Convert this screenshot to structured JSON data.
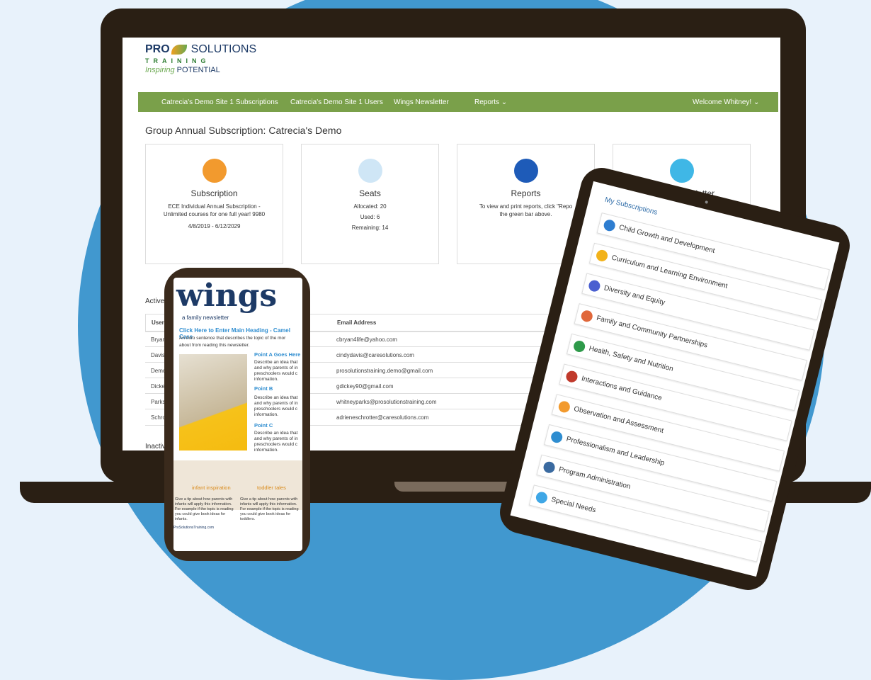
{
  "logo": {
    "pro": "PRO",
    "solutions": "SOLUTIONS",
    "training": "TRAINING",
    "tagline_a": "Inspiring",
    "tagline_b": "POTENTIAL"
  },
  "nav": {
    "items": [
      "Catrecia's Demo Site 1 Subscriptions",
      "Catrecia's Demo Site 1 Users",
      "Wings Newsletter",
      "Reports ⌄"
    ],
    "welcome": "Welcome Whitney! ⌄"
  },
  "page_title": "Group Annual Subscription: Catrecia's Demo",
  "cards": {
    "subscription": {
      "title": "Subscription",
      "line1": "ECE Individual Annual Subscription -",
      "line2": "Unlimited courses for one full year! 9980",
      "dates": "4/8/2019 - 6/12/2029",
      "icon": "books-icon",
      "color": "#f29a2e"
    },
    "seats": {
      "title": "Seats",
      "allocated": "Allocated: 20",
      "used": "Used: 6",
      "remaining": "Remaining: 14",
      "icon": "people-icon",
      "color": "#cfe6f6"
    },
    "reports": {
      "title": "Reports",
      "line1": "To view and print reports, click \"Repo",
      "line2": "the green bar above.",
      "icon": "bar-chart-icon",
      "color": "#1e5bb8"
    },
    "newsletter": {
      "title": "Wings Newsletter",
      "icon": "owl-icon",
      "color": "#3fb7e6"
    }
  },
  "users": {
    "section_label": "Active",
    "header_user": "User",
    "header_email": "Email Address",
    "rows": [
      {
        "user": "Bryan",
        "email": "cbryan4life@yahoo.com"
      },
      {
        "user": "Davis",
        "email": "cindydavis@caresolutions.com"
      },
      {
        "user": "Demo",
        "email": "prosolutionstraining.demo@gmail.com"
      },
      {
        "user": "Dickey",
        "email": "gdickey90@gmail.com"
      },
      {
        "user": "Parks,",
        "email": "whitneyparks@prosolutionstraining.com"
      },
      {
        "user": "Schro",
        "email": "adrieneschrotter@caresolutions.com"
      }
    ],
    "inactive_label": "Inactiv"
  },
  "phone": {
    "wings": "wings",
    "family": "a family newsletter",
    "heading": "Click Here to Enter Main Heading - Camel Case",
    "intro1": "An intro sentence that describes the topic of the mor",
    "intro2": "about from reading this newsletter.",
    "point_a": "Point A Goes Here",
    "point_b": "Point B",
    "point_c": "Point C",
    "desc1": "Describe an idea that",
    "desc2": "and why parents of in",
    "desc3": "preschoolers would c",
    "desc4": "information.",
    "infant": "infant inspiration",
    "toddler": "toddler tales",
    "tip_infant": "Give a tip about how parents with infants will apply this information. For example if the topic is reading you could give book ideas for infants.",
    "tip_toddler": "Give a tip about how parents with infants will apply this information. For example if the topic is reading you could give book ideas for toddlers.",
    "footer": "ProSolutionsTraining.com"
  },
  "tablet": {
    "title": "My Subscriptions",
    "items": [
      {
        "label": "Child Growth and Development",
        "color": "#2e7dd0"
      },
      {
        "label": "Curriculum and Learning Environment",
        "color": "#f2b21a"
      },
      {
        "label": "Diversity and Equity",
        "color": "#4a5fd0"
      },
      {
        "label": "Family and Community Partnerships",
        "color": "#e0673a"
      },
      {
        "label": "Health, Safety and Nutrition",
        "color": "#2e9a4a"
      },
      {
        "label": "Interactions and Guidance",
        "color": "#c0392b"
      },
      {
        "label": "Observation and Assessment",
        "color": "#f29a2e"
      },
      {
        "label": "Professionalism and Leadership",
        "color": "#2e8dd0"
      },
      {
        "label": "Program Administration",
        "color": "#3a6aa0"
      },
      {
        "label": "Special Needs",
        "color": "#3fa7e6"
      }
    ]
  }
}
